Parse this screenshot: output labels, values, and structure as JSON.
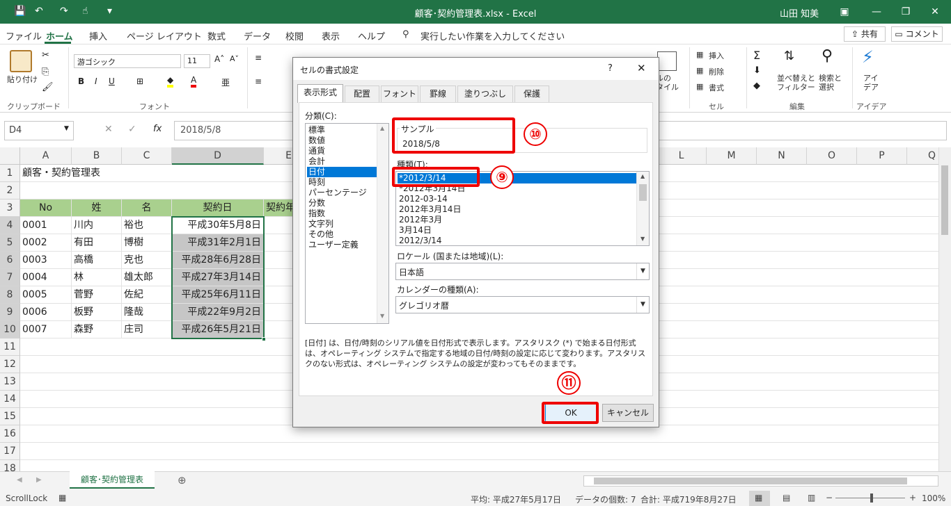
{
  "titlebar": {
    "title": "顧客･契約管理表.xlsx  -  Excel",
    "user": "山田 知美"
  },
  "menu": {
    "tabs": [
      "ファイル",
      "ホーム",
      "挿入",
      "ページ レイアウト",
      "数式",
      "データ",
      "校閲",
      "表示",
      "ヘルプ"
    ],
    "tell_me": "実行したい作業を入力してください",
    "share": "共有",
    "comment": "コメント"
  },
  "ribbon": {
    "paste": "貼り付け",
    "clipboard": "クリップボード",
    "font_name": "游ゴシック",
    "font_size": "11",
    "font_group": "フォント",
    "insert": "挿入",
    "delete": "削除",
    "format": "書式",
    "cells_group": "セル",
    "sort_filter": "並べ替えと\nフィルター",
    "find_select": "検索と\n選択",
    "editing_group": "編集",
    "ideas": "アイ\nデア",
    "ideas_group": "アイデア",
    "style_partial": "ルの\nタイル"
  },
  "formula": {
    "namebox": "D4",
    "value": "2018/5/8"
  },
  "columns": [
    "A",
    "B",
    "C",
    "D",
    "E",
    "L",
    "M",
    "N",
    "O",
    "P",
    "Q"
  ],
  "rows": [
    "1",
    "2",
    "3",
    "4",
    "5",
    "6",
    "7",
    "8",
    "9",
    "10",
    "11",
    "12",
    "13",
    "14",
    "15",
    "16",
    "17",
    "18"
  ],
  "sheet": {
    "title": "顧客・契約管理表",
    "headers": [
      "No",
      "姓",
      "名",
      "契約日",
      "契約年"
    ],
    "data": [
      [
        "0001",
        "川内",
        "裕也",
        "平成30年5月8日"
      ],
      [
        "0002",
        "有田",
        "博樹",
        "平成31年2月1日"
      ],
      [
        "0003",
        "高橋",
        "克也",
        "平成28年6月28日"
      ],
      [
        "0004",
        "林",
        "雄太郎",
        "平成27年3月14日"
      ],
      [
        "0005",
        "菅野",
        "佐紀",
        "平成25年6月11日"
      ],
      [
        "0006",
        "板野",
        "隆哉",
        "平成22年9月2日"
      ],
      [
        "0007",
        "森野",
        "庄司",
        "平成26年5月21日"
      ]
    ]
  },
  "sheet_tab": "顧客･契約管理表",
  "status": {
    "mode": "ScrollLock",
    "average": "平均: 平成27年5月17日",
    "count": "データの個数: 7",
    "sum": "合計: 平成719年8月27日",
    "zoom": "100%"
  },
  "dialog": {
    "title": "セルの書式設定",
    "help": "?",
    "tabs": [
      "表示形式",
      "配置",
      "フォント",
      "罫線",
      "塗りつぶし",
      "保護"
    ],
    "category_label": "分類(C):",
    "categories": [
      "標準",
      "数値",
      "通貨",
      "会計",
      "日付",
      "時刻",
      "パーセンテージ",
      "分数",
      "指数",
      "文字列",
      "その他",
      "ユーザー定義"
    ],
    "selected_category": "日付",
    "sample_label": "サンプル",
    "sample_value": "2018/5/8",
    "type_label": "種類(T):",
    "types": [
      "*2012/3/14",
      "*2012年3月14日",
      "2012-03-14",
      "2012年3月14日",
      "2012年3月",
      "3月14日",
      "2012/3/14"
    ],
    "locale_label": "ロケール (国または地域)(L):",
    "locale_value": "日本語",
    "calendar_label": "カレンダーの種類(A):",
    "calendar_value": "グレゴリオ暦",
    "description": "[日付] は、日付/時刻のシリアル値を日付形式で表示します。アスタリスク (*) で始まる日付形式は、オペレーティング システムで指定する地域の日付/時刻の設定に応じて変わります。アスタリスクのない形式は、オペレーティング システムの設定が変わってもそのままです。",
    "ok": "OK",
    "cancel": "キャンセル"
  },
  "annotations": {
    "n9": "⑨",
    "n10": "⑩",
    "n11": "⑪"
  },
  "colors": {
    "excel_green": "#217346",
    "header_fill": "#a9d08e",
    "annotation_red": "#ee0000",
    "selection_blue": "#0078d7"
  }
}
